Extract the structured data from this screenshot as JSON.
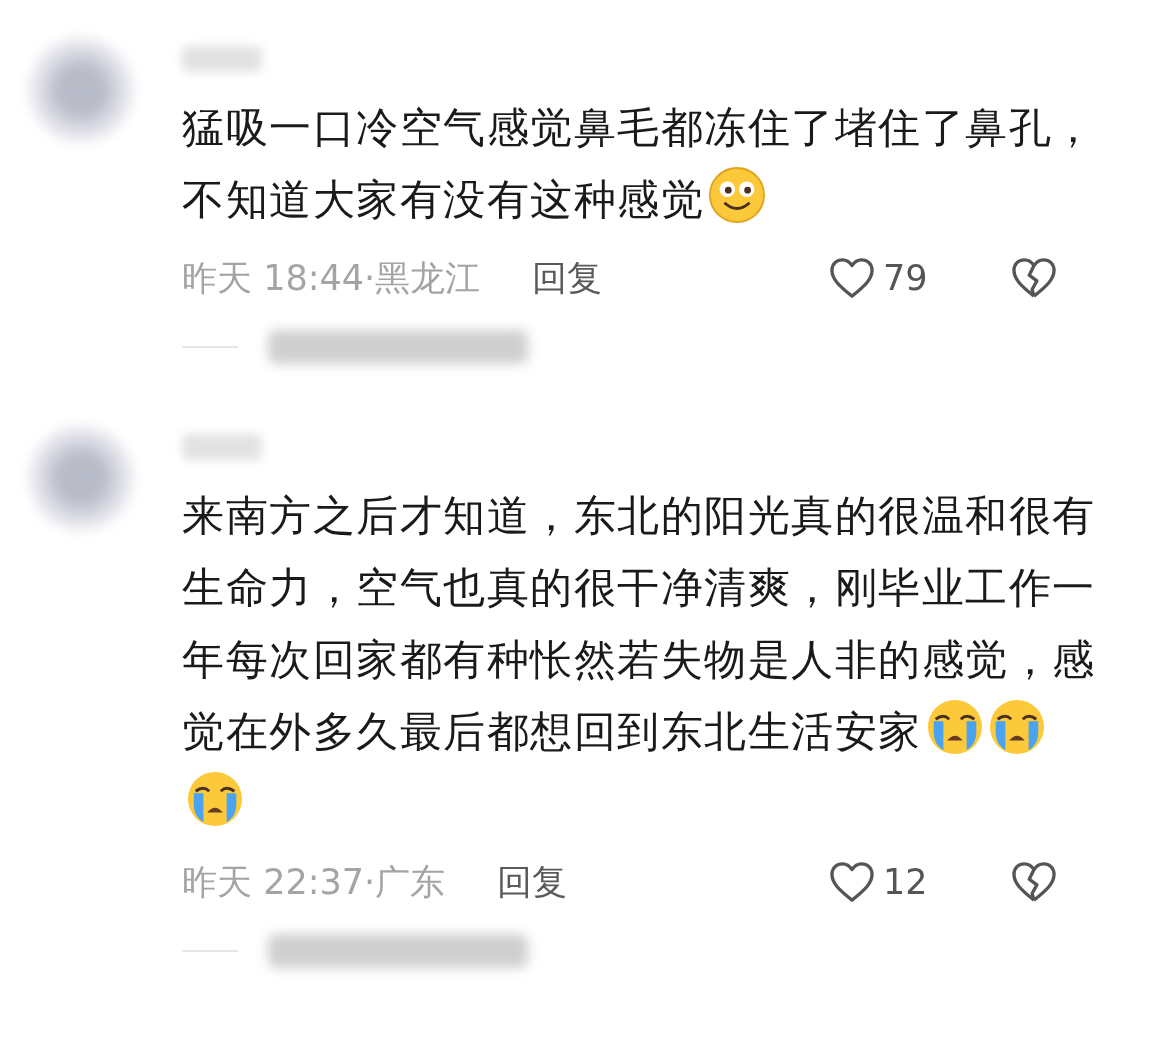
{
  "comments": [
    {
      "body": [
        {
          "kind": "line",
          "text": "猛吸一口冷空气感觉鼻毛都冻住了堵住了鼻孔，"
        },
        {
          "kind": "text",
          "text": "不知道大家有没有这种感觉"
        },
        {
          "kind": "smile"
        }
      ],
      "time": "昨天 18:44·黑龙江",
      "reply": "回复",
      "likes": "79"
    },
    {
      "body": [
        {
          "kind": "line",
          "text": "来南方之后才知道，东北的阳光真的很温和很有"
        },
        {
          "kind": "line",
          "text": "生命力，空气也真的很干净清爽，刚毕业工作一"
        },
        {
          "kind": "line",
          "text": "年每次回家都有种怅然若失物是人非的感觉，感"
        },
        {
          "kind": "text",
          "text": "觉在外多久最后都想回到东北生活安家"
        },
        {
          "kind": "cry"
        },
        {
          "kind": "cry"
        },
        {
          "kind": "cry"
        }
      ],
      "time": "昨天 22:37·广东",
      "reply": "回复",
      "likes": "12"
    }
  ]
}
